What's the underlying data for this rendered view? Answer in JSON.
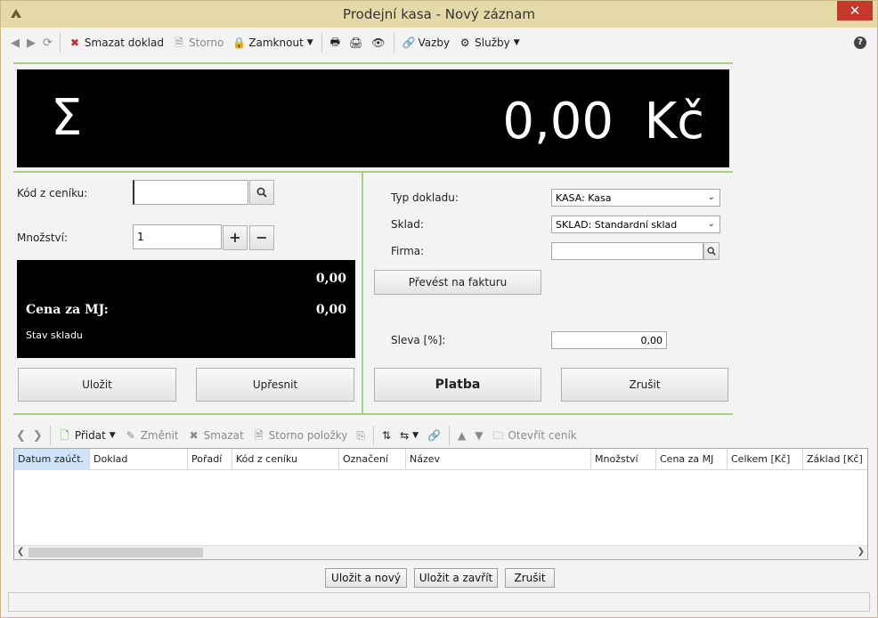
{
  "window": {
    "title": "Prodejní kasa - Nový záznam",
    "close": "✕"
  },
  "toolbar": {
    "delete": "Smazat doklad",
    "storno": "Storno",
    "lock": "Zamknout",
    "links": "Vazby",
    "services": "Služby",
    "help": "?"
  },
  "summary": {
    "sigma": "Σ",
    "total": "0,00",
    "currency": "Kč"
  },
  "left": {
    "code_label": "Kód z ceníku:",
    "code_value": "",
    "qty_label": "Množství:",
    "qty_value": "1",
    "plus": "+",
    "minus": "−",
    "price_top": "0,00",
    "price_label": "Cena za MJ:",
    "price_value": "0,00",
    "stock_label": "Stav skladu",
    "save": "Uložit",
    "refine": "Upřesnit"
  },
  "right": {
    "doctype_label": "Typ dokladu:",
    "doctype_value": "KASA: Kasa",
    "warehouse_label": "Sklad:",
    "warehouse_value": "SKLAD: Standardní sklad",
    "company_label": "Firma:",
    "company_value": "",
    "to_invoice": "Převést na fakturu",
    "discount_label": "Sleva [%]:",
    "discount_value": "0,00",
    "pay": "Platba",
    "cancel": "Zrušit"
  },
  "items_toolbar": {
    "add": "Přidat",
    "edit": "Změnit",
    "delete": "Smazat",
    "storno_items": "Storno položky",
    "open_pricelist": "Otevřít ceník"
  },
  "grid": {
    "columns": [
      "Datum zaúčt.",
      "Doklad",
      "Pořadí",
      "Kód z ceníku",
      "Označení",
      "Název",
      "Množství",
      "Cena za MJ",
      "Celkem [Kč]",
      "Základ [Kč]"
    ]
  },
  "footer": {
    "save_new": "Uložit a nový",
    "save_close": "Uložit a zavřít",
    "cancel": "Zrušit"
  }
}
